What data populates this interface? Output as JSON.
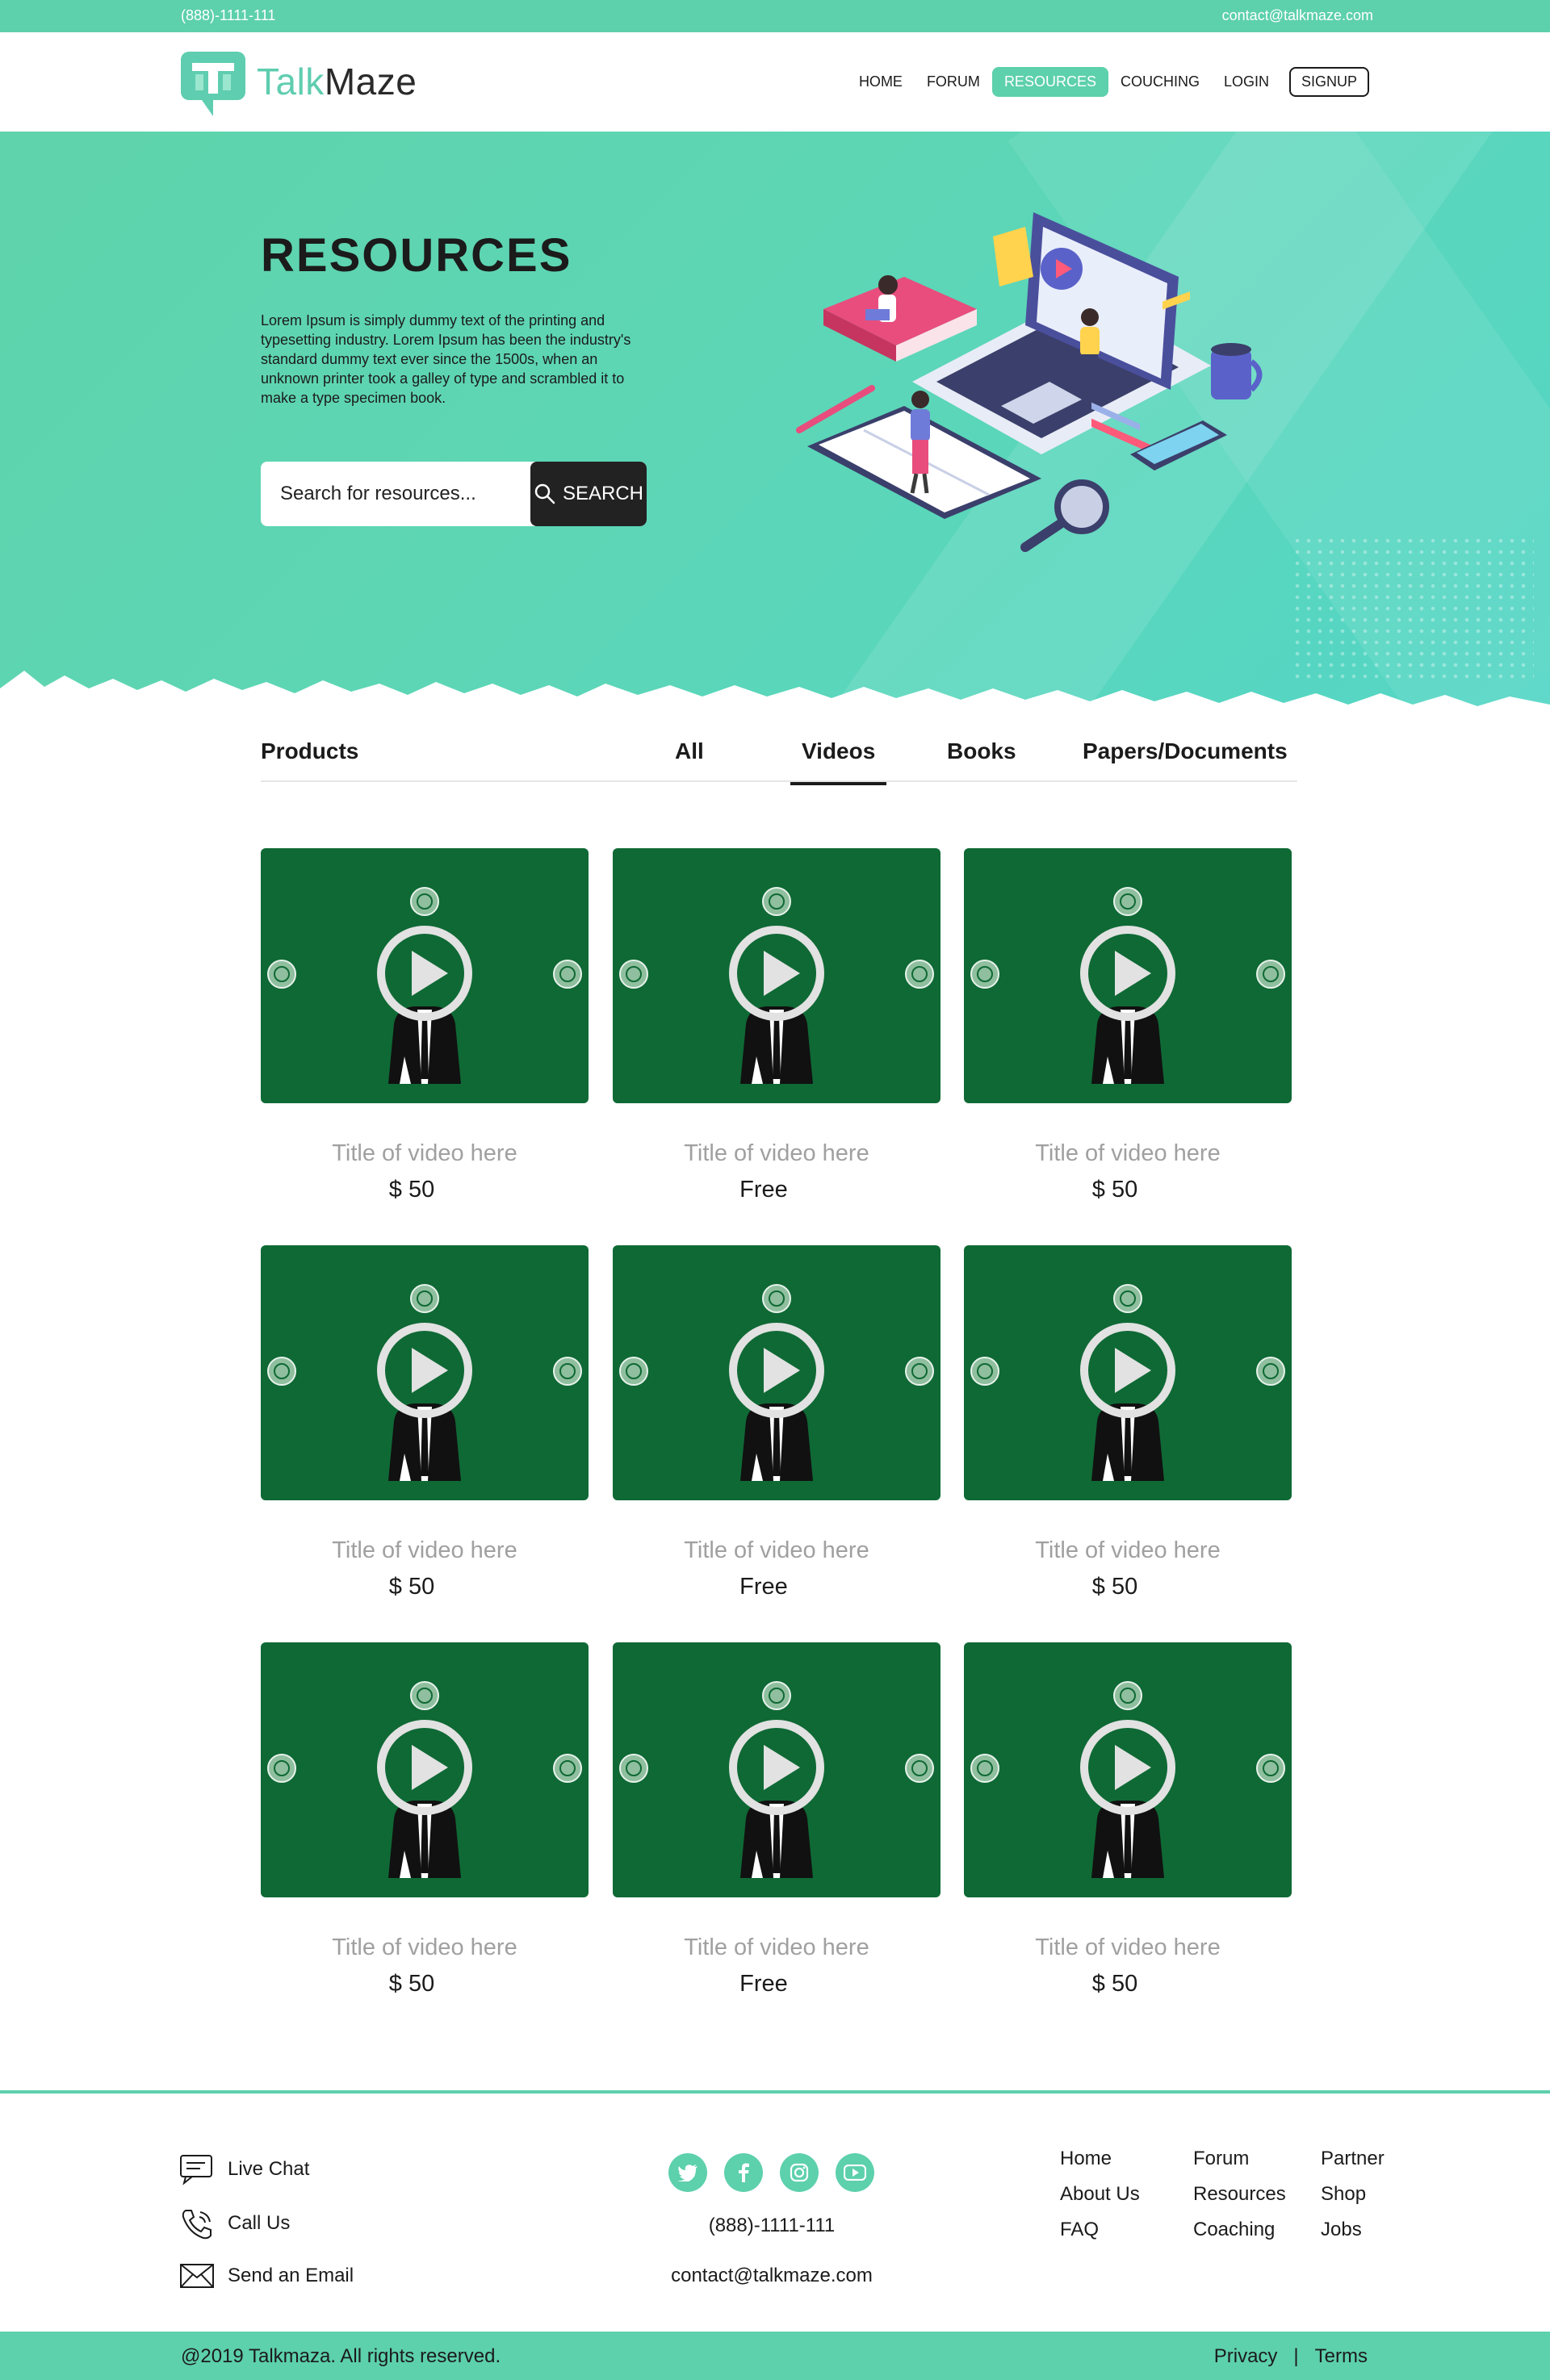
{
  "topbar": {
    "phone": "(888)-1111-111",
    "email": "contact@talkmaze.com"
  },
  "brand": {
    "name_part1": "Talk",
    "name_part2": "Maze",
    "color": "#5dd0ac"
  },
  "nav": {
    "items": [
      {
        "label": "HOME",
        "active": false
      },
      {
        "label": "FORUM",
        "active": false
      },
      {
        "label": "RESOURCES",
        "active": true
      },
      {
        "label": "COUCHING",
        "active": false
      },
      {
        "label": "LOGIN",
        "active": false
      }
    ],
    "signup": "SIGNUP"
  },
  "hero": {
    "title": "RESOURCES",
    "text": "Lorem Ipsum is simply dummy text of the printing and typesetting industry. Lorem Ipsum has been the industry's standard dummy text ever since the 1500s, when an unknown printer took a galley of type and scrambled it to make a type specimen book.",
    "search_placeholder": "Search for resources...",
    "search_button": "SEARCH"
  },
  "tabs": {
    "heading": "Products",
    "items": [
      "All",
      "Videos",
      "Books",
      "Papers/Documents"
    ],
    "active": "Videos"
  },
  "videos": [
    {
      "title": "Title of video here",
      "price": "$ 50"
    },
    {
      "title": "Title of video here",
      "price": "Free"
    },
    {
      "title": "Title of video here",
      "price": "$ 50"
    },
    {
      "title": "Title of video here",
      "price": "$ 50"
    },
    {
      "title": "Title of video here",
      "price": "Free"
    },
    {
      "title": "Title of video here",
      "price": "$ 50"
    },
    {
      "title": "Title of video here",
      "price": "$ 50"
    },
    {
      "title": "Title of video here",
      "price": "Free"
    },
    {
      "title": "Title of video here",
      "price": "$ 50"
    }
  ],
  "footer": {
    "contacts": [
      {
        "label": "Live Chat",
        "icon": "chat-icon"
      },
      {
        "label": "Call Us",
        "icon": "phone-icon"
      },
      {
        "label": "Send an Email",
        "icon": "mail-icon"
      }
    ],
    "socials": [
      "twitter-icon",
      "facebook-icon",
      "instagram-icon",
      "youtube-icon"
    ],
    "phone": "(888)-1111-111",
    "email": "contact@talkmaze.com",
    "links_col1": [
      "Home",
      "About Us",
      "FAQ"
    ],
    "links_col2": [
      "Forum",
      "Resources",
      "Coaching"
    ],
    "links_col3": [
      "Partner",
      "Shop",
      "Jobs"
    ]
  },
  "bottom": {
    "copyright": "@2019 Talkmaza. All rights reserved.",
    "privacy": "Privacy",
    "separator": "|",
    "terms": "Terms"
  }
}
